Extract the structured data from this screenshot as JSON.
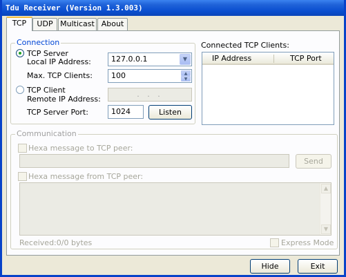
{
  "window": {
    "title": "Tdu Receiver (Version 1.3.003)"
  },
  "tabs": [
    {
      "label": "TCP",
      "active": true
    },
    {
      "label": "UDP",
      "active": false
    },
    {
      "label": "Multicast",
      "active": false
    },
    {
      "label": "About",
      "active": false
    }
  ],
  "connection": {
    "legend": "Connection",
    "tcp_server_label": "TCP Server",
    "local_ip_label": "Local IP Address:",
    "local_ip_value": "127.0.0.1",
    "max_clients_label": "Max. TCP Clients:",
    "max_clients_value": "100",
    "tcp_client_label": "TCP Client",
    "remote_ip_label": "Remote IP Address:",
    "remote_ip_value": ".   .   .",
    "server_port_label": "TCP Server Port:",
    "server_port_value": "1024",
    "listen_label": "Listen",
    "selected_mode": "TCP Server"
  },
  "clients": {
    "title": "Connected TCP Clients:",
    "columns": [
      "IP Address",
      "TCP Port"
    ],
    "rows": []
  },
  "communication": {
    "legend": "Communication",
    "hexa_to_label": "Hexa message to TCP peer:",
    "send_label": "Send",
    "hexa_from_label": "Hexa message from TCP peer:",
    "received_text": "Received:0/0 bytes",
    "express_mode_label": "Express Mode"
  },
  "footer": {
    "hide_label": "Hide",
    "exit_label": "Exit"
  },
  "colors": {
    "titlebar": "#0a4fd0",
    "legend": "#0046d5",
    "window_bg": "#ece9d8",
    "active_tab_accent": "#f3bd3f"
  }
}
